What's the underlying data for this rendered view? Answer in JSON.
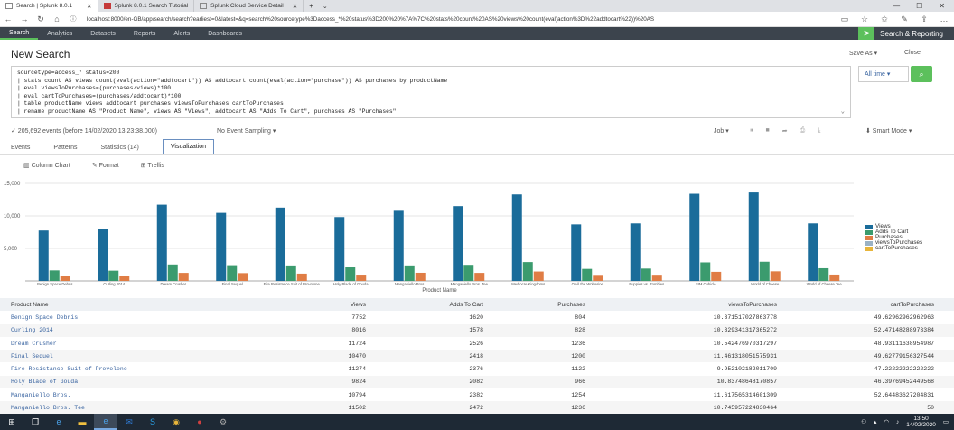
{
  "browser": {
    "tabs": [
      {
        "label": "Search | Splunk 8.0.1",
        "active": true
      },
      {
        "label": "Splunk 8.0.1 Search Tutorial",
        "active": false
      },
      {
        "label": "Splunk Cloud Service Detail",
        "active": false
      }
    ],
    "url": "localhost:8000/en-GB/app/search/search?earliest=0&latest=&q=search%20sourcetype%3Daccess_*%20status%3D200%20%7A%7C%20stats%20count%20AS%20views%20count(eval(action%3D%22addtocart%22))%20AS"
  },
  "appbar": {
    "tabs": [
      "Search",
      "Analytics",
      "Datasets",
      "Reports",
      "Alerts",
      "Dashboards"
    ],
    "active_tab": "Search",
    "app_name": "Search & Reporting"
  },
  "header": {
    "title": "New Search",
    "save_as": "Save As ▾",
    "close": "Close"
  },
  "search": {
    "lines": [
      "sourcetype=access_* status=200",
      "| stats count AS views count(eval(action=\"addtocart\")) AS addtocart count(eval(action=\"purchase\")) AS purchases by productName",
      "| eval viewsToPurchases=(purchases/views)*100",
      "| eval cartToPurchases=(purchases/addtocart)*100",
      "| table productName views addtocart purchases viewsToPurchases cartToPurchases",
      "| rename productName AS \"Product Name\", views AS \"Views\", addtocart AS \"Adds To Cart\", purchases AS \"Purchases\""
    ],
    "time_range": "All time ▾"
  },
  "status": {
    "events": "✓ 205,692 events (before 14/02/2020 13:23:38.000)",
    "sampling": "No Event Sampling ▾",
    "job": "Job ▾",
    "mode": "⬇ Smart Mode ▾"
  },
  "result_tabs": [
    "Events",
    "Patterns",
    "Statistics (14)",
    "Visualization"
  ],
  "active_result_tab": "Visualization",
  "viz_tools": [
    "Column Chart",
    "Format",
    "Trellis"
  ],
  "chart_data": {
    "type": "bar",
    "xlabel": "Product Name",
    "ylim": [
      0,
      15000
    ],
    "yticks": [
      "15,000",
      "10,000",
      "5,000"
    ],
    "categories": [
      "Benign Space Debris",
      "Curling 2014",
      "Dream Crusher",
      "Final Sequel",
      "Fire Resistance Suit of Provolone",
      "Holy Blade of Gouda",
      "Manganiello Bros.",
      "Manganiello Bros. Tee",
      "Mediocre Kingdoms",
      "Orvil the Wolverine",
      "Puppies vs. Zombies",
      "SIM Cubicle",
      "World of Cheese",
      "World of Cheese Tee"
    ],
    "series": [
      {
        "name": "Views",
        "color": "#1a6c9a",
        "values": [
          7752,
          8016,
          11724,
          10470,
          11274,
          9824,
          10784,
          11502,
          13300,
          8700,
          8850,
          13400,
          13600,
          8850
        ]
      },
      {
        "name": "Adds To Cart",
        "color": "#3b9b6e",
        "values": [
          1620,
          1578,
          2526,
          2418,
          2378,
          2082,
          2382,
          2472,
          2900,
          1850,
          1900,
          2850,
          2950,
          1950
        ]
      },
      {
        "name": "Purchases",
        "color": "#e07d45",
        "values": [
          804,
          828,
          1236,
          1200,
          1122,
          966,
          1254,
          1236,
          1450,
          930,
          950,
          1400,
          1480,
          980
        ]
      },
      {
        "name": "viewsToPurchases",
        "color": "#9ab2c5",
        "values": [
          10.37,
          10.33,
          10.54,
          11.46,
          9.95,
          9.83,
          11.62,
          10.75,
          10.9,
          10.7,
          10.7,
          10.4,
          10.9,
          11.1
        ]
      },
      {
        "name": "cartToPurchases",
        "color": "#e8b53a",
        "values": [
          49.63,
          52.47,
          48.93,
          49.63,
          47.22,
          46.4,
          52.64,
          50,
          50,
          50.3,
          50,
          49.1,
          50.2,
          50.3
        ]
      }
    ]
  },
  "table": {
    "columns": [
      "Product Name",
      "Views",
      "Adds To Cart",
      "Purchases",
      "viewsToPurchases",
      "cartToPurchases"
    ],
    "rows": [
      [
        "Benign Space Debris",
        "7752",
        "1620",
        "804",
        "10.371517027863778",
        "49.62962962962963"
      ],
      [
        "Curling 2014",
        "8016",
        "1578",
        "828",
        "10.329341317365272",
        "52.47148288973384"
      ],
      [
        "Dream Crusher",
        "11724",
        "2526",
        "1236",
        "10.542476970317297",
        "48.93111638954987"
      ],
      [
        "Final Sequel",
        "10470",
        "2418",
        "1200",
        "11.461318051575931",
        "49.62779156327544"
      ],
      [
        "Fire Resistance Suit of Provolone",
        "11274",
        "2376",
        "1122",
        "9.952102182011709",
        "47.22222222222222"
      ],
      [
        "Holy Blade of Gouda",
        "9824",
        "2082",
        "966",
        "10.83748648170857",
        "46.39769452449568"
      ],
      [
        "Manganiello Bros.",
        "10794",
        "2382",
        "1254",
        "11.617565314601309",
        "52.64483627204831"
      ],
      [
        "Manganiello Bros. Tee",
        "11502",
        "2472",
        "1236",
        "10.745957224830464",
        "50"
      ]
    ]
  },
  "taskbar": {
    "time": "13:50",
    "date": "14/02/2020"
  }
}
